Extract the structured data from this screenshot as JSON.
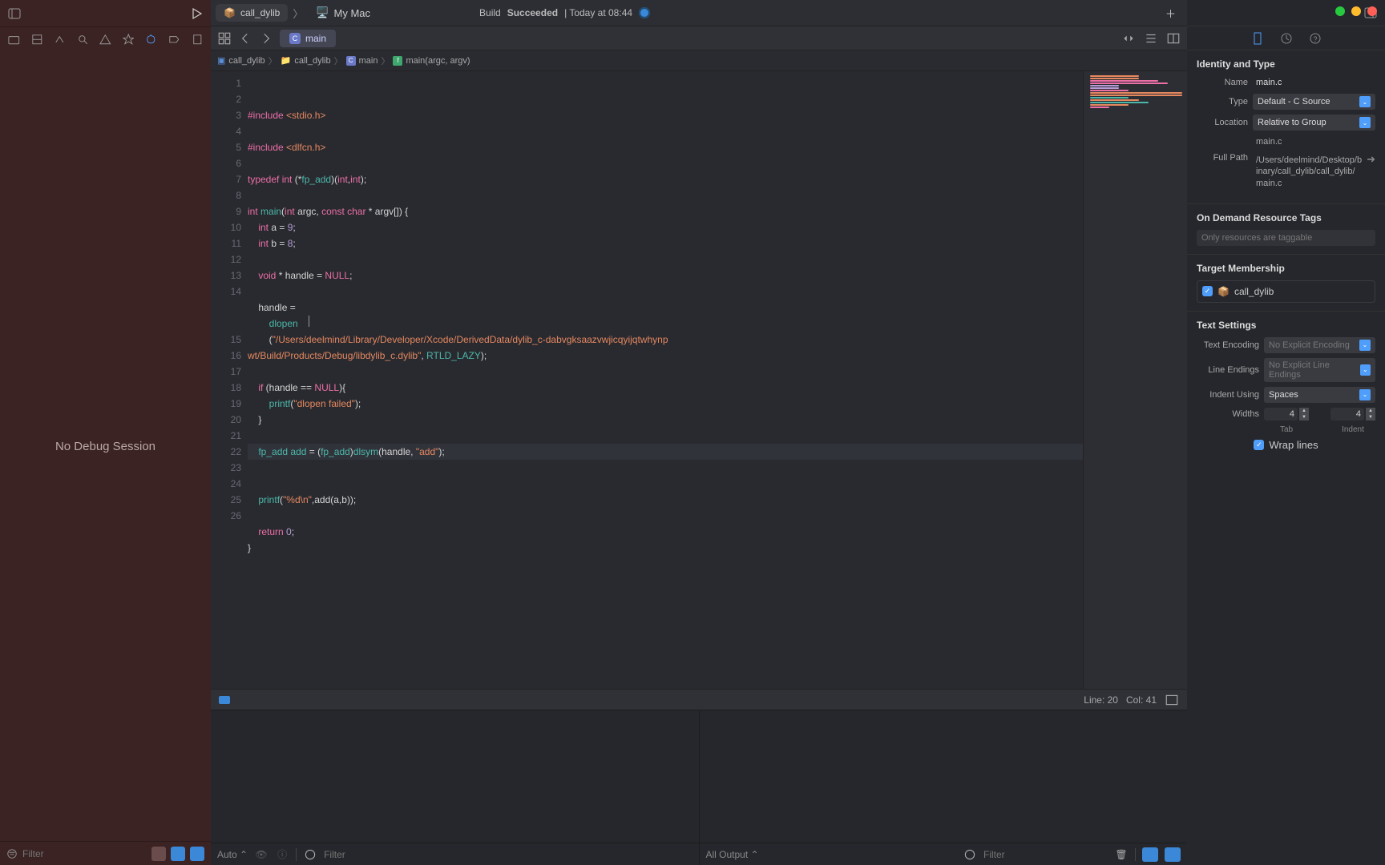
{
  "window": {
    "title": "call_dylib"
  },
  "left": {
    "body_text": "No Debug Session",
    "filter_placeholder": "Filter"
  },
  "center": {
    "scheme": "call_dylib",
    "destination": "My Mac",
    "build_status": "Build ",
    "build_status_bold": "Succeeded",
    "build_time": " | Today at 08:44",
    "open_tab": "main",
    "breadcrumbs": {
      "project": "call_dylib",
      "folder": "call_dylib",
      "file": "main",
      "symbol": "main(argc, argv)"
    },
    "status": {
      "line": "Line: 20",
      "col": "Col: 41"
    },
    "debug": {
      "auto": "Auto",
      "filter_placeholder": "Filter",
      "output_mode": "All Output",
      "filter2_placeholder": "Filter"
    }
  },
  "code": {
    "lines": [
      "",
      "#include <stdio.h>",
      "",
      "#include <dlfcn.h>",
      "",
      "typedef int (*fp_add)(int,int);",
      "",
      "int main(int argc, const char * argv[]) {",
      "    int a = 9;",
      "    int b = 8;",
      "",
      "    void * handle = NULL;",
      "",
      "    handle =",
      "        dlopen",
      "        (\"/Users/deelmind/Library/Developer/Xcode/DerivedData/dylib_c-dabvgksaazvwjicqyijqtwhynp",
      "wt/Build/Products/Debug/libdylib_c.dylib\", RTLD_LAZY);",
      "",
      "    if (handle == NULL){",
      "        printf(\"dlopen failed\");",
      "    }",
      "",
      "    fp_add add = (fp_add)dlsym(handle, \"add\");",
      "",
      "    printf(\"%d\\n\",add(a,b));",
      "",
      "    return 0;",
      "}",
      ""
    ],
    "line_numbers": [
      "1",
      "2",
      "3",
      "4",
      "5",
      "6",
      "7",
      "8",
      "9",
      "10",
      "11",
      "12",
      "13",
      "14",
      "",
      "",
      "15",
      "16",
      "17",
      "18",
      "19",
      "20",
      "21",
      "22",
      "23",
      "24",
      "25",
      "26"
    ]
  },
  "inspector": {
    "identity": {
      "title": "Identity and Type",
      "name_label": "Name",
      "name_value": "main.c",
      "type_label": "Type",
      "type_value": "Default - C Source",
      "location_label": "Location",
      "location_value": "Relative to Group",
      "location_file": "main.c",
      "fullpath_label": "Full Path",
      "fullpath_value": "/Users/deelmind/Desktop/binary/call_dylib/call_dylib/main.c"
    },
    "ondemand": {
      "title": "On Demand Resource Tags",
      "placeholder": "Only resources are taggable"
    },
    "target": {
      "title": "Target Membership",
      "target_name": "call_dylib"
    },
    "text": {
      "title": "Text Settings",
      "encoding_label": "Text Encoding",
      "encoding_value": "No Explicit Encoding",
      "lineendings_label": "Line Endings",
      "lineendings_value": "No Explicit Line Endings",
      "indentusing_label": "Indent Using",
      "indentusing_value": "Spaces",
      "widths_label": "Widths",
      "tab_label": "Tab",
      "indent_label": "Indent",
      "tab_value": "4",
      "indent_value": "4",
      "wrap_label": "Wrap lines"
    }
  }
}
